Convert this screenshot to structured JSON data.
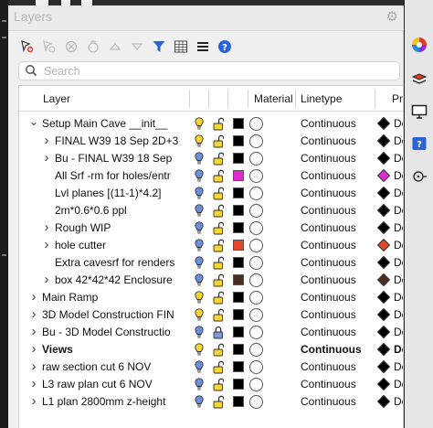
{
  "panel": {
    "title": "Layers",
    "search_placeholder": "Search"
  },
  "toolbar": {
    "icons": [
      "new-layer-icon",
      "new-sublayer-icon",
      "delete-icon",
      "filter-off-icon",
      "move-up-icon",
      "move-down-icon",
      "filter-icon",
      "table-icon",
      "menu-icon",
      "help-icon"
    ]
  },
  "columns": {
    "layer": "Layer",
    "material": "Material",
    "linetype": "Linetype",
    "print": "Prin"
  },
  "colors": {
    "accent_blue": "#2b63d6",
    "bulb_on": "#f5d532",
    "bulb_off": "#6d8fd9",
    "lock_open": "#f5d532",
    "lock_closed": "#7b98d8"
  },
  "layers": [
    {
      "name": "Setup Main Cave __init__",
      "indent": 0,
      "expander": "open",
      "bulb": "on",
      "lock": "open",
      "color": "#000000",
      "linetype": "Continuous",
      "print_color": "#000000",
      "print": "Def",
      "bold": false
    },
    {
      "name": "FINAL W39 18 Sep 2D+3",
      "indent": 1,
      "expander": "closed",
      "bulb": "on",
      "lock": "open",
      "color": "#000000",
      "linetype": "Continuous",
      "print_color": "#000000",
      "print": "Def",
      "bold": false
    },
    {
      "name": "Bu - FINAL W39 18 Sep",
      "indent": 1,
      "expander": "closed",
      "bulb": "off",
      "lock": "open",
      "color": "#000000",
      "linetype": "Continuous",
      "print_color": "#000000",
      "print": "Def",
      "bold": false
    },
    {
      "name": "All Srf -rm for holes/entr",
      "indent": 1,
      "expander": "none",
      "bulb": "off",
      "lock": "open",
      "color": "#e02bd0",
      "linetype": "Continuous",
      "print_color": "#e02bd0",
      "print": "Def",
      "bold": false
    },
    {
      "name": "Lvl planes [(11-1)*4.2]",
      "indent": 1,
      "expander": "none",
      "bulb": "off",
      "lock": "open",
      "color": "#000000",
      "linetype": "Continuous",
      "print_color": "#000000",
      "print": "Def",
      "bold": false
    },
    {
      "name": "2m*0.6*0.6 ppl",
      "indent": 1,
      "expander": "none",
      "bulb": "off",
      "lock": "open",
      "color": "#000000",
      "linetype": "Continuous",
      "print_color": "#000000",
      "print": "Def",
      "bold": false
    },
    {
      "name": "Rough WIP",
      "indent": 1,
      "expander": "closed",
      "bulb": "off",
      "lock": "open",
      "color": "#000000",
      "linetype": "Continuous",
      "print_color": "#000000",
      "print": "Def",
      "bold": false
    },
    {
      "name": "hole cutter",
      "indent": 1,
      "expander": "closed",
      "bulb": "off",
      "lock": "open",
      "color": "#e2492a",
      "linetype": "Continuous",
      "print_color": "#e2492a",
      "print": "Def",
      "bold": false
    },
    {
      "name": "Extra cavesrf for renders",
      "indent": 1,
      "expander": "none",
      "bulb": "off",
      "lock": "open",
      "color": "#000000",
      "linetype": "Continuous",
      "print_color": "#000000",
      "print": "Def",
      "bold": false
    },
    {
      "name": "box 42*42*42 Enclosure",
      "indent": 1,
      "expander": "closed",
      "bulb": "off",
      "lock": "open",
      "color": "#4a2e22",
      "linetype": "Continuous",
      "print_color": "#4a2e22",
      "print": "Def",
      "bold": false
    },
    {
      "name": "Main Ramp",
      "indent": 0,
      "expander": "closed",
      "bulb": "on",
      "lock": "open",
      "color": "#000000",
      "linetype": "Continuous",
      "print_color": "#000000",
      "print": "Def",
      "bold": false
    },
    {
      "name": "3D Model Construction FIN",
      "indent": 0,
      "expander": "closed",
      "bulb": "on",
      "lock": "open",
      "color": "#000000",
      "linetype": "Continuous",
      "print_color": "#000000",
      "print": "Def",
      "bold": false
    },
    {
      "name": "Bu - 3D Model Constructio",
      "indent": 0,
      "expander": "closed",
      "bulb": "off",
      "lock": "closed",
      "color": "#000000",
      "linetype": "Continuous",
      "print_color": "#000000",
      "print": "Def",
      "bold": false
    },
    {
      "name": "Views",
      "indent": 0,
      "expander": "closed",
      "bulb": "on",
      "lock": "open",
      "color": "#000000",
      "linetype": "Continuous",
      "print_color": "#000000",
      "print": "Def",
      "bold": true
    },
    {
      "name": "raw section cut 6 NOV",
      "indent": 0,
      "expander": "closed",
      "bulb": "off",
      "lock": "open",
      "color": "#000000",
      "linetype": "Continuous",
      "print_color": "#000000",
      "print": "Def",
      "bold": false
    },
    {
      "name": "L3 raw plan cut 6 NOV",
      "indent": 0,
      "expander": "closed",
      "bulb": "off",
      "lock": "open",
      "color": "#000000",
      "linetype": "Continuous",
      "print_color": "#000000",
      "print": "Def",
      "bold": false
    },
    {
      "name": "L1 plan 2800mm z-height",
      "indent": 0,
      "expander": "closed",
      "bulb": "off",
      "lock": "open",
      "color": "#000000",
      "linetype": "Continuous",
      "print_color": "#000000",
      "print": "Def",
      "bold": false
    }
  ]
}
